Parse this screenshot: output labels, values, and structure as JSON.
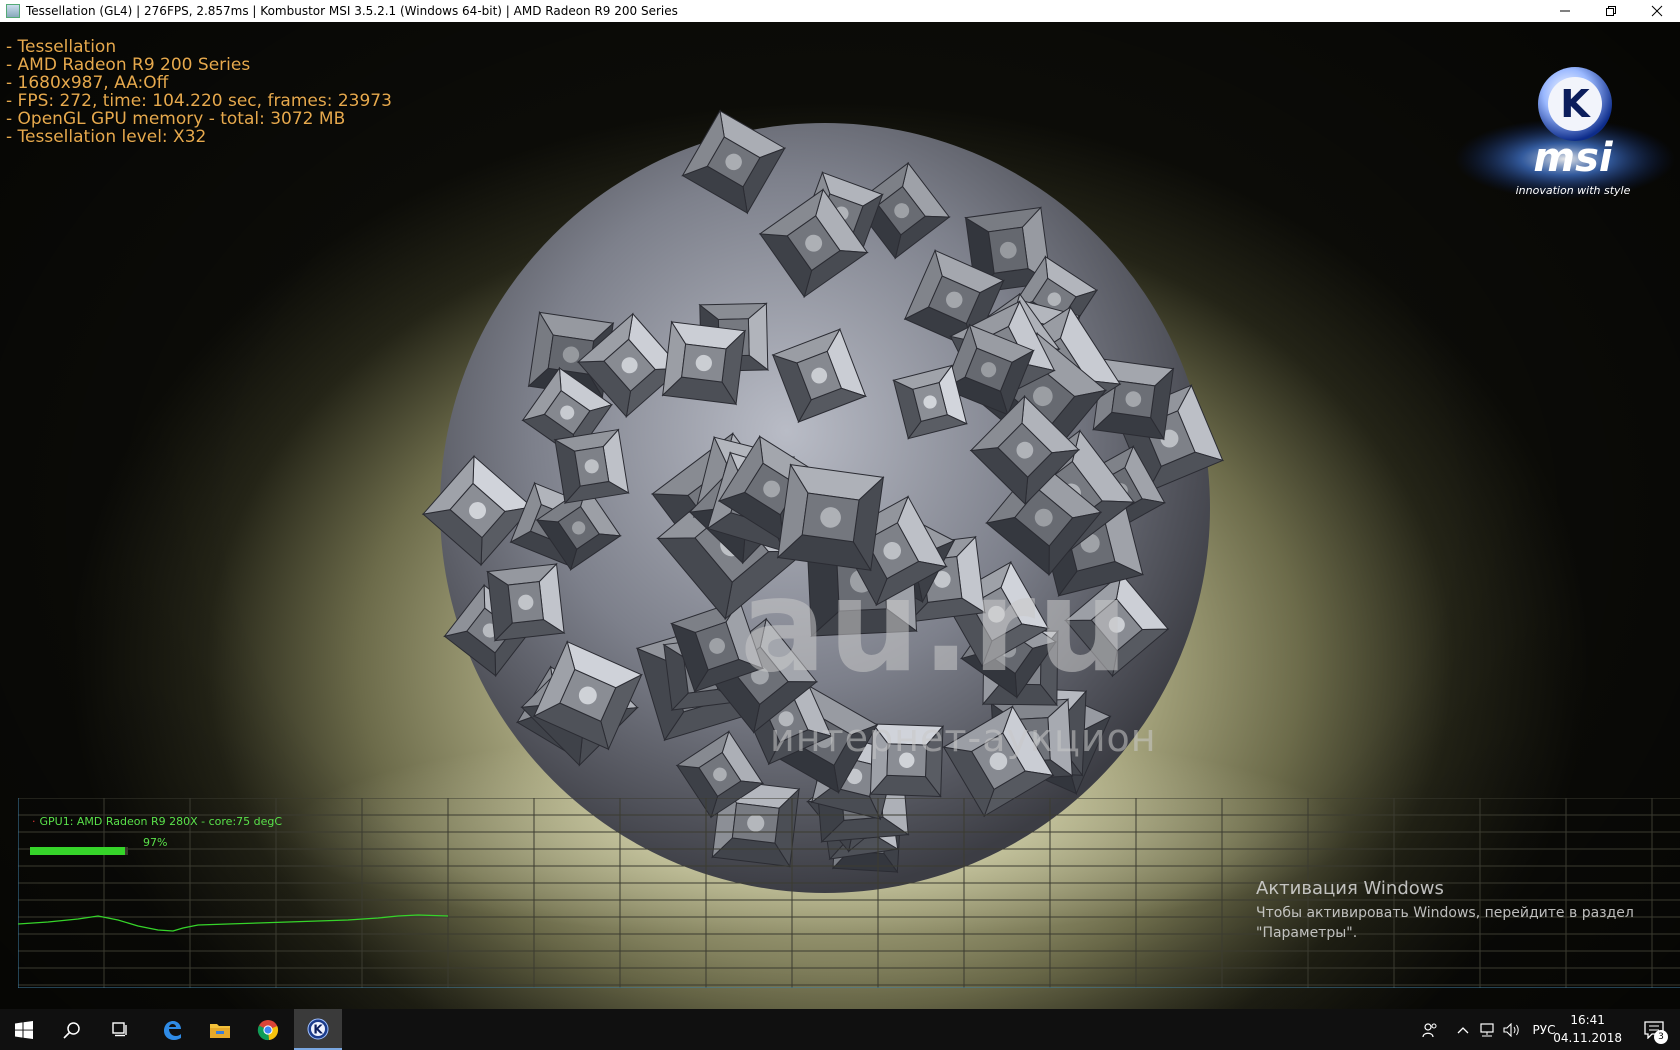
{
  "window": {
    "title": "Tessellation (GL4) | 276FPS, 2.857ms | Kombustor MSI 3.5.2.1 (Windows 64-bit) | AMD Radeon R9 200 Series",
    "minimize_icon": "minimize-icon",
    "restore_icon": "restore-icon",
    "close_icon": "close-icon"
  },
  "overlay": {
    "lines": [
      "- Tessellation",
      "- AMD Radeon R9 200 Series",
      "- 1680x987, AA:Off",
      "- FPS: 272, time: 104.220 sec, frames: 23973",
      "- OpenGL GPU memory - total: 3072 MB",
      "- Tessellation level: X32"
    ],
    "color": "#e6a94d"
  },
  "logo": {
    "letter": "K",
    "brand": "msi",
    "tagline": "innovation with style"
  },
  "watermark": {
    "main": "au.ru",
    "sub": "интернет-аукцион"
  },
  "monitor": {
    "gpu_label": "GPU1: AMD Radeon R9 280X - core:75 degC",
    "usage_percent": 97,
    "usage_text": "97%",
    "line_color": "#36d42a",
    "grid_color": "#3b3b30"
  },
  "activation": {
    "title": "Активация Windows",
    "line1": "Чтобы активировать Windows, перейдите в раздел",
    "line2": "\"Параметры\"."
  },
  "taskbar": {
    "apps": [
      "windows-start-icon",
      "search-icon",
      "task-view-icon",
      "edge-icon",
      "file-explorer-icon",
      "chrome-icon",
      "kombustor-icon"
    ],
    "language": "РУС",
    "time": "16:41",
    "date": "04.11.2018",
    "notification_count": "3"
  }
}
